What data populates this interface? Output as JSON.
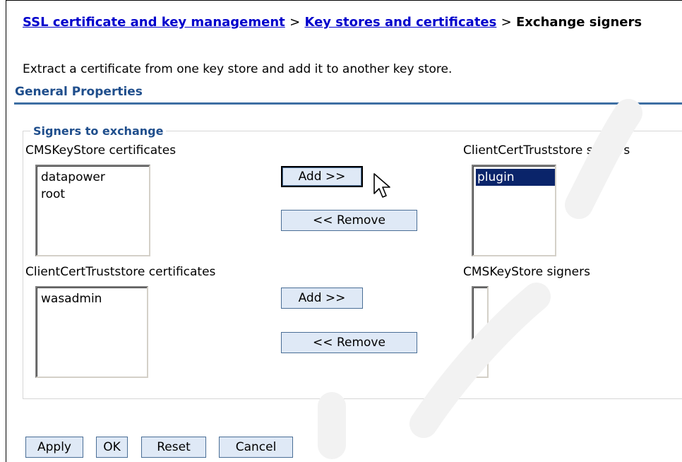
{
  "breadcrumb": {
    "link1": "SSL certificate and key management",
    "sep1": ">",
    "link2": "Key stores and certificates",
    "sep2": ">",
    "current": "Exchange signers"
  },
  "description": "Extract a certificate from one key store and add it to another key store.",
  "section_title": "General Properties",
  "fieldset_legend": "Signers to exchange",
  "top": {
    "left_label": "CMSKeyStore certificates",
    "left_items": [
      "datapower",
      "root"
    ],
    "right_label": "ClientCertTruststore signers",
    "right_items": [
      "plugin"
    ],
    "add_label": "Add >>",
    "remove_label": "<< Remove"
  },
  "bottom": {
    "left_label": "ClientCertTruststore certificates",
    "left_items": [
      "wasadmin"
    ],
    "right_label": "CMSKeyStore signers",
    "right_items": [],
    "add_label": "Add >>",
    "remove_label": "<< Remove"
  },
  "actions": {
    "apply": "Apply",
    "ok": "OK",
    "reset": "Reset",
    "cancel": "Cancel"
  },
  "colors": {
    "link": "#0000cc",
    "section": "#1f4e8c",
    "selection": "#0a246a",
    "button_bg": "#dfe9f6"
  }
}
